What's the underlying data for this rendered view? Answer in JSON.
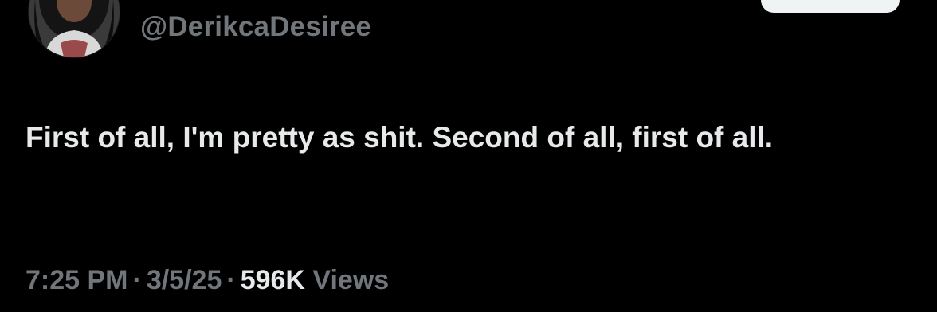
{
  "author": {
    "handle": "@DerikcaDesiree",
    "avatar_icon": "profile-photo"
  },
  "follow_button": {
    "label": "",
    "color": "#eff3f4"
  },
  "tweet": {
    "text": "First of all, I'm pretty as shit. Second of all, first of all."
  },
  "meta": {
    "time": "7:25 PM",
    "separator": "·",
    "date": "3/5/25",
    "views_count": "596K",
    "views_label": "Views"
  },
  "colors": {
    "background": "#000000",
    "primary_text": "#e7e9ea",
    "secondary_text": "#71767b"
  }
}
